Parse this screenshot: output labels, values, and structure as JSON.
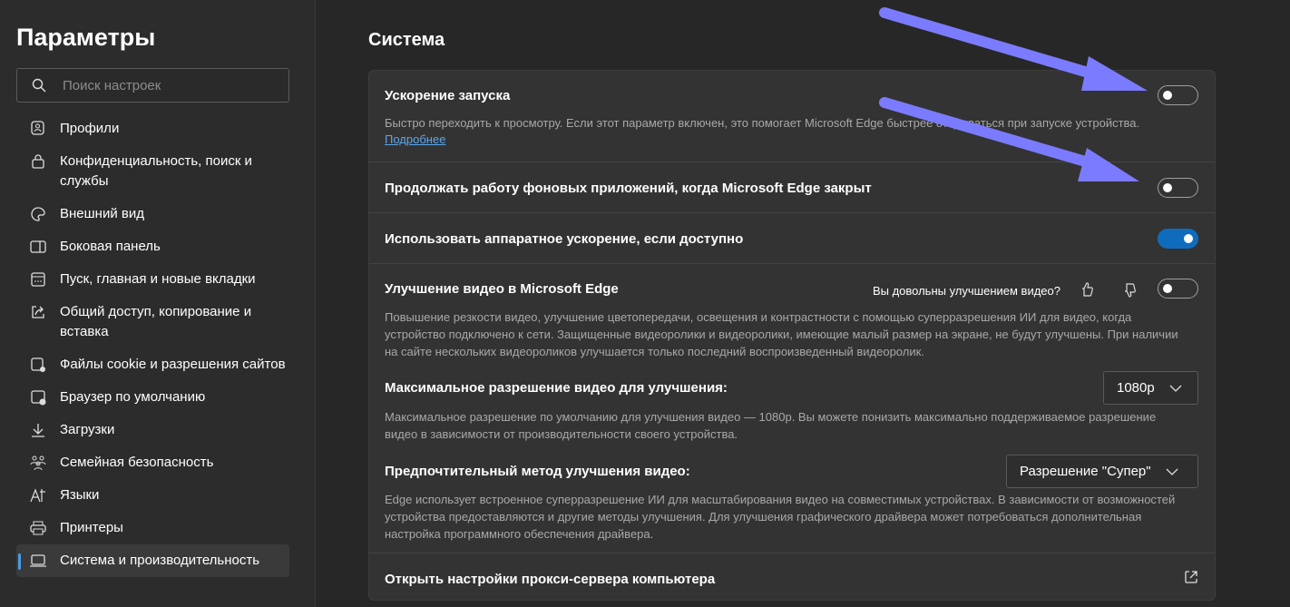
{
  "sidebar": {
    "title": "Параметры",
    "search_placeholder": "Поиск настроек",
    "items": [
      {
        "label": "Профили",
        "icon": "profile-icon"
      },
      {
        "label": "Конфиденциальность, поиск и службы",
        "icon": "lock-icon"
      },
      {
        "label": "Внешний вид",
        "icon": "palette-icon"
      },
      {
        "label": "Боковая панель",
        "icon": "sidebar-icon"
      },
      {
        "label": "Пуск, главная и новые вкладки",
        "icon": "home-tab-icon"
      },
      {
        "label": "Общий доступ, копирование и вставка",
        "icon": "share-icon"
      },
      {
        "label": "Файлы cookie и разрешения сайтов",
        "icon": "cookie-settings-icon"
      },
      {
        "label": "Браузер по умолчанию",
        "icon": "default-browser-icon"
      },
      {
        "label": "Загрузки",
        "icon": "download-icon"
      },
      {
        "label": "Семейная безопасность",
        "icon": "family-icon"
      },
      {
        "label": "Языки",
        "icon": "languages-icon"
      },
      {
        "label": "Принтеры",
        "icon": "printer-icon"
      },
      {
        "label": "Система и производительность",
        "icon": "laptop-icon",
        "active": true
      }
    ]
  },
  "main": {
    "title": "Система",
    "startup_boost": {
      "label": "Ускорение запуска",
      "desc": "Быстро переходить к просмотру. Если этот параметр включен, это помогает Microsoft Edge быстрее открываться при запуске устройства.",
      "link": "Подробнее",
      "on": false
    },
    "background_apps": {
      "label": "Продолжать работу фоновых приложений, когда Microsoft Edge закрыт",
      "on": false
    },
    "hw_accel": {
      "label": "Использовать аппаратное ускорение, если доступно",
      "on": true
    },
    "video": {
      "label": "Улучшение видео в Microsoft Edge",
      "feedback": "Вы довольны улучшением видео?",
      "on": false,
      "desc": "Повышение резкости видео, улучшение цветопередачи, освещения и контрастности с помощью суперразрешения ИИ для видео, когда устройство подключено к сети. Защищенные видеоролики и видеоролики, имеющие малый размер на экране, не будут улучшены. При наличии на сайте нескольких видеороликов улучшается только последний воспроизведенный видеоролик.",
      "max_res_label": "Максимальное разрешение видео для улучшения:",
      "max_res_value": "1080p",
      "max_res_desc": "Максимальное разрешение по умолчанию для улучшения видео — 1080p. Вы можете понизить максимально поддерживаемое разрешение видео в зависимости от производительности своего устройства.",
      "method_label": "Предпочтительный метод улучшения видео:",
      "method_value": "Разрешение \"Супер\"",
      "method_desc": "Edge использует встроенное суперразрешение ИИ для масштабирования видео на совместимых устройствах. В зависимости от возможностей устройства предоставляются и другие методы улучшения. Для улучшения графического драйвера может потребоваться дополнительная настройка программного обеспечения драйвера."
    },
    "proxy": {
      "label": "Открыть настройки прокси-сервера компьютера"
    }
  },
  "colors": {
    "accent": "#0f6cbd",
    "arrow": "#7b7bff",
    "link": "#5aa6f0"
  }
}
